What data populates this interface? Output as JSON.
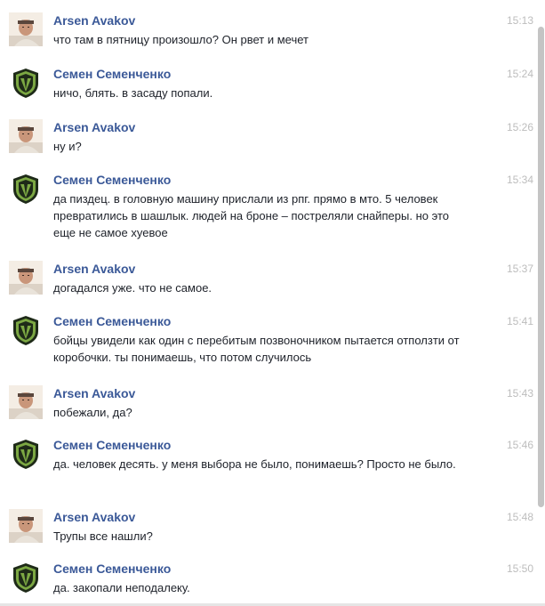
{
  "messages": [
    {
      "author": "Arsen Avakov",
      "time": "15:13",
      "text": "что там в пятницу произошло? Он рвет и мечет",
      "avatar": "avakov-photo"
    },
    {
      "author": "Семен Семенченко",
      "time": "15:24",
      "text": "ничо, блять. в засаду попали.",
      "avatar": "shield-emblem"
    },
    {
      "author": "Arsen Avakov",
      "time": "15:26",
      "text": "ну и?",
      "avatar": "avakov-photo"
    },
    {
      "author": "Семен Семенченко",
      "time": "15:34",
      "text": "да пиздец. в головную машину прислали из рпг. прямо в мто. 5 человек превратились в шашлык. людей на броне – постреляли снайперы. но это еще не самое хуевое",
      "avatar": "shield-emblem"
    },
    {
      "author": "Arsen Avakov",
      "time": "15:37",
      "text": "догадался уже. что не самое.",
      "avatar": "avakov-photo"
    },
    {
      "author": "Семен Семенченко",
      "time": "15:41",
      "text": "бойцы увидели как один с перебитым позвоночником пытается отползти от коробочки. ты понимаешь, что потом случилось",
      "avatar": "shield-emblem"
    },
    {
      "author": "Arsen Avakov",
      "time": "15:43",
      "text": "побежали, да?",
      "avatar": "avakov-photo"
    },
    {
      "author": "Семен Семенченко",
      "time": "15:46",
      "text": "да. человек десять. у меня выбора не было, понимаешь? Просто не было.",
      "avatar": "shield-emblem"
    },
    {
      "author": "Arsen Avakov",
      "time": "15:48",
      "text": "Трупы все нашли?",
      "avatar": "avakov-photo"
    },
    {
      "author": "Семен Семенченко",
      "time": "15:50",
      "text": "да. закопали неподалеку.",
      "avatar": "shield-emblem"
    }
  ],
  "colors": {
    "author_link": "#3b5998",
    "timestamp": "#bdbdbd",
    "message_text": "#1d2129",
    "shield_green": "#7ca843",
    "shield_dark": "#1e2a18"
  }
}
